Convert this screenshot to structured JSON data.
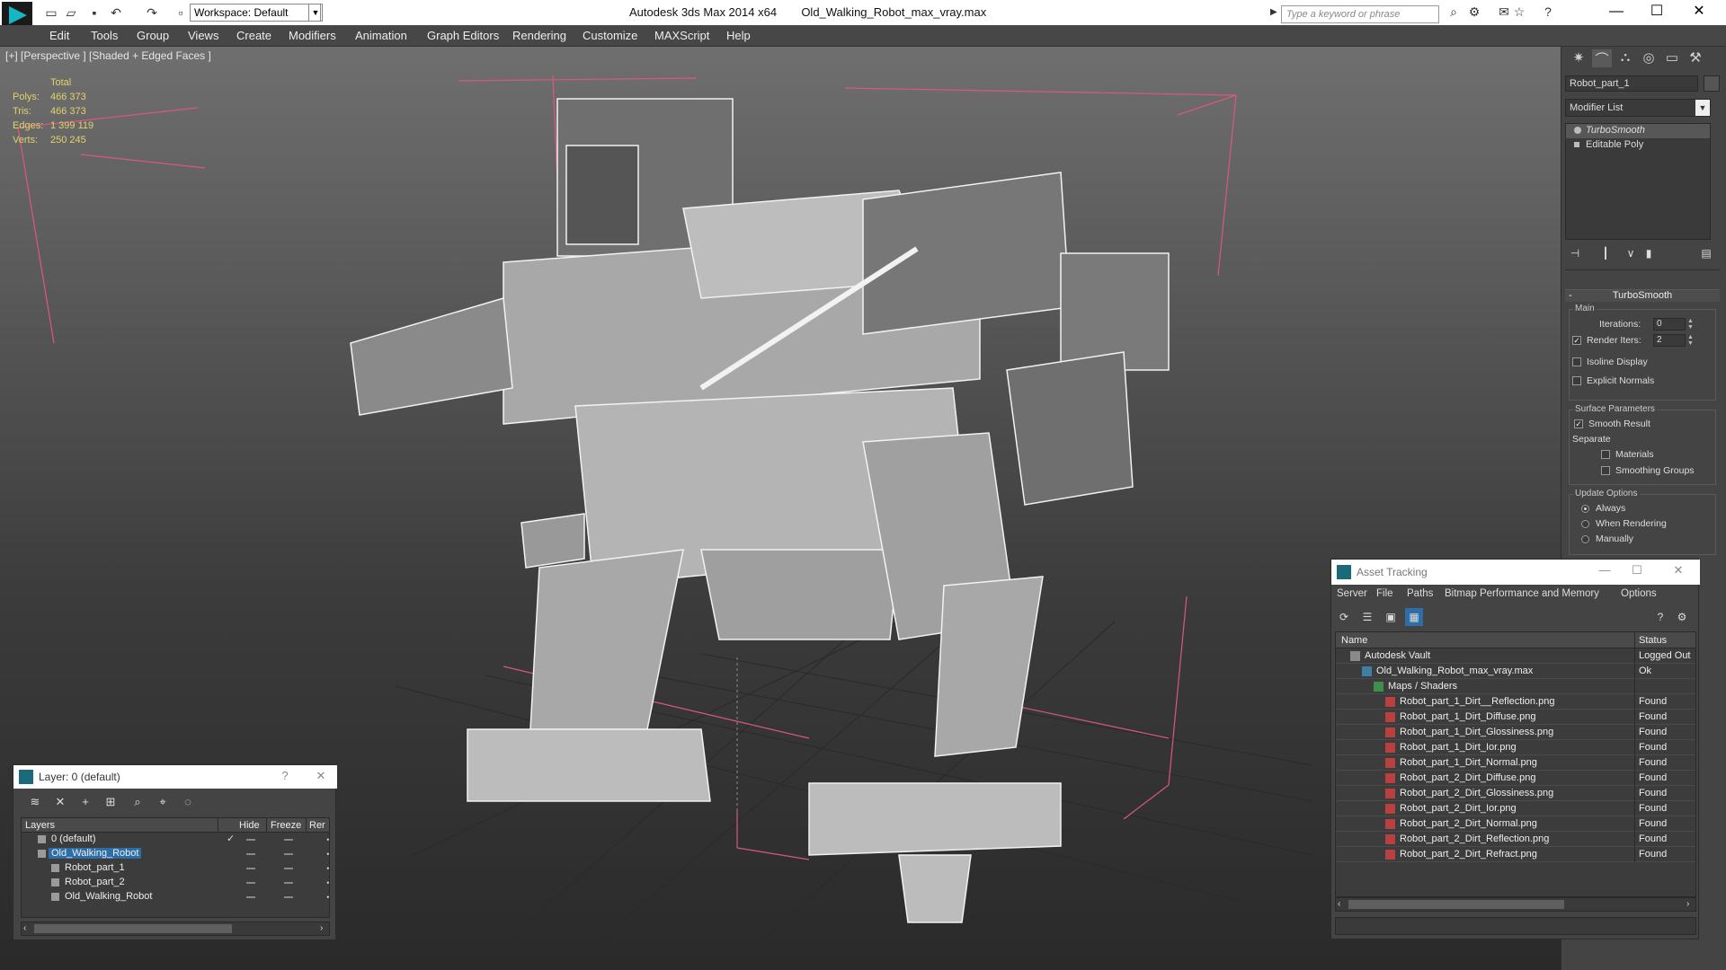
{
  "app": {
    "title": "Autodesk 3ds Max 2014 x64",
    "file": "Old_Walking_Robot_max_vray.max",
    "workspace": "Workspace: Default",
    "search_placeholder": "Type a keyword or phrase"
  },
  "menu": [
    "Edit",
    "Tools",
    "Group",
    "Views",
    "Create",
    "Modifiers",
    "Animation",
    "Graph Editors",
    "Rendering",
    "Customize",
    "MAXScript",
    "Help"
  ],
  "viewport": {
    "label": "[+] [Perspective ] [Shaded + Edged Faces ]",
    "stats": {
      "header": "Total",
      "rows": [
        {
          "k": "Polys:",
          "v": "466 373"
        },
        {
          "k": "Tris:",
          "v": "466 373"
        },
        {
          "k": "Edges:",
          "v": "1 399 119"
        },
        {
          "k": "Verts:",
          "v": "250 245"
        }
      ]
    }
  },
  "command_panel": {
    "object_name": "Robot_part_1",
    "modifier_list": "Modifier List",
    "stack": [
      "TurboSmooth",
      "Editable Poly"
    ],
    "rollout": "TurboSmooth",
    "main": {
      "title": "Main",
      "iterations_label": "Iterations:",
      "iterations": "0",
      "render_iters_label": "Render Iters:",
      "render_iters": "2",
      "isoline": "Isoline Display",
      "explicit_normals": "Explicit Normals"
    },
    "surface": {
      "title": "Surface Parameters",
      "smooth_result": "Smooth Result",
      "separate": "Separate",
      "materials": "Materials",
      "smoothing_groups": "Smoothing Groups"
    },
    "update": {
      "title": "Update Options",
      "always": "Always",
      "when_rendering": "When Rendering",
      "manually": "Manually"
    }
  },
  "asset_tracking": {
    "title": "Asset Tracking",
    "menu": [
      "Server",
      "File",
      "Paths",
      "Bitmap Performance and Memory",
      "Options"
    ],
    "col_name": "Name",
    "col_status": "Status",
    "rows": [
      {
        "name": "Autodesk Vault",
        "status": "Logged Out",
        "level": 0,
        "icon": "vault"
      },
      {
        "name": "Old_Walking_Robot_max_vray.max",
        "status": "Ok",
        "level": 1,
        "icon": "file"
      },
      {
        "name": "Maps / Shaders",
        "status": "",
        "level": 2,
        "icon": "map"
      },
      {
        "name": "Robot_part_1_Dirt__Reflection.png",
        "status": "Found",
        "level": 3,
        "icon": "png"
      },
      {
        "name": "Robot_part_1_Dirt_Diffuse.png",
        "status": "Found",
        "level": 3,
        "icon": "png"
      },
      {
        "name": "Robot_part_1_Dirt_Glossiness.png",
        "status": "Found",
        "level": 3,
        "icon": "png"
      },
      {
        "name": "Robot_part_1_Dirt_Ior.png",
        "status": "Found",
        "level": 3,
        "icon": "png"
      },
      {
        "name": "Robot_part_1_Dirt_Normal.png",
        "status": "Found",
        "level": 3,
        "icon": "png"
      },
      {
        "name": "Robot_part_2_Dirt_Diffuse.png",
        "status": "Found",
        "level": 3,
        "icon": "png"
      },
      {
        "name": "Robot_part_2_Dirt_Glossiness.png",
        "status": "Found",
        "level": 3,
        "icon": "png"
      },
      {
        "name": "Robot_part_2_Dirt_Ior.png",
        "status": "Found",
        "level": 3,
        "icon": "png"
      },
      {
        "name": "Robot_part_2_Dirt_Normal.png",
        "status": "Found",
        "level": 3,
        "icon": "png"
      },
      {
        "name": "Robot_part_2_Dirt_Reflection.png",
        "status": "Found",
        "level": 3,
        "icon": "png"
      },
      {
        "name": "Robot_part_2_Dirt_Refract.png",
        "status": "Found",
        "level": 3,
        "icon": "png"
      }
    ]
  },
  "layer": {
    "title": "Layer: 0 (default)",
    "help": "?",
    "cols": [
      "Layers",
      "Hide",
      "Freeze",
      "Rer"
    ],
    "rows": [
      {
        "name": "0 (default)",
        "level": 0,
        "check": true
      },
      {
        "name": "Old_Walking_Robot",
        "level": 0,
        "selected": true
      },
      {
        "name": "Robot_part_1",
        "level": 1
      },
      {
        "name": "Robot_part_2",
        "level": 1
      },
      {
        "name": "Old_Walking_Robot",
        "level": 1
      }
    ]
  }
}
